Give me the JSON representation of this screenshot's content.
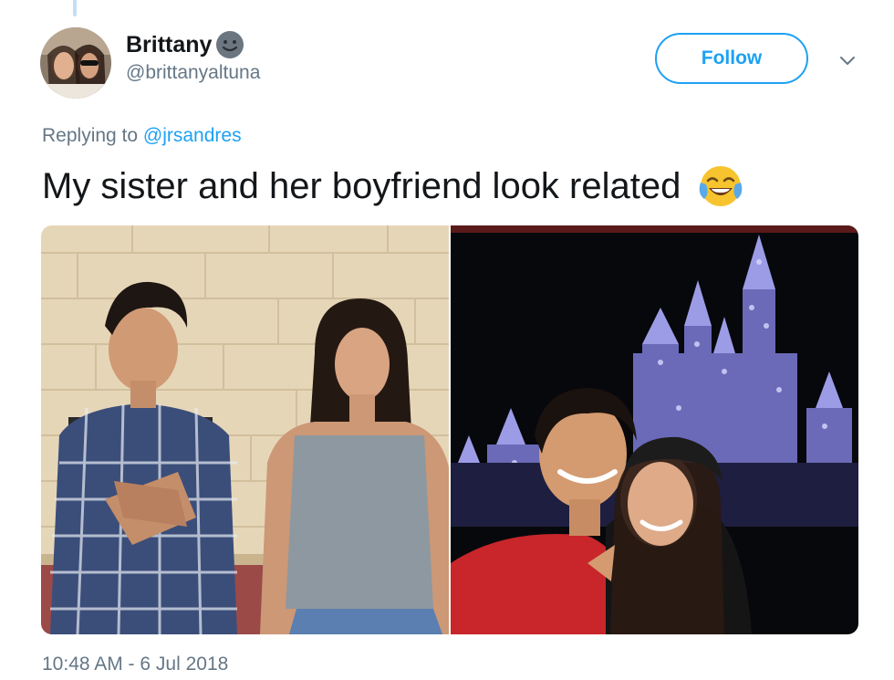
{
  "tweet": {
    "author": {
      "display_name": "Brittany",
      "handle": "@brittanyaltuna",
      "badge_emoji": "smiling-face-icon"
    },
    "follow_label": "Follow",
    "reply": {
      "prefix": "Replying to ",
      "mention": "@jrsandres"
    },
    "text": "My sister and her boyfriend look related",
    "text_emoji": "face-with-tears-of-joy-icon",
    "timestamp": "10:48 AM - 6 Jul 2018",
    "media": [
      {
        "name": "photo-boy-and-girl-by-wall"
      },
      {
        "name": "photo-couple-at-castle-night"
      }
    ]
  },
  "colors": {
    "accent": "#1da1f2",
    "muted": "#657786",
    "text": "#14171a"
  }
}
